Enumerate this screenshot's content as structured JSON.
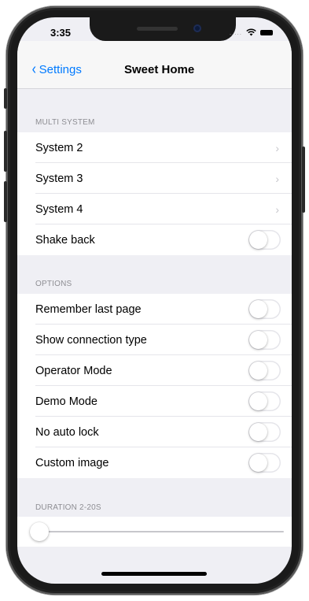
{
  "status_bar": {
    "time": "3:35",
    "signal": "....."
  },
  "nav": {
    "back_label": "Settings",
    "title": "Sweet Home"
  },
  "sections": {
    "multi_system": {
      "header": "MULTI SYSTEM",
      "rows": [
        {
          "label": "System 2",
          "control": "chevron"
        },
        {
          "label": "System 3",
          "control": "chevron"
        },
        {
          "label": "System 4",
          "control": "chevron"
        },
        {
          "label": "Shake back",
          "control": "toggle",
          "on": false
        }
      ]
    },
    "options": {
      "header": "OPTIONS",
      "rows": [
        {
          "label": "Remember last page",
          "control": "toggle",
          "on": false
        },
        {
          "label": "Show connection type",
          "control": "toggle",
          "on": false
        },
        {
          "label": "Operator Mode",
          "control": "toggle",
          "on": false
        },
        {
          "label": "Demo Mode",
          "control": "toggle",
          "on": false
        },
        {
          "label": "No auto lock",
          "control": "toggle",
          "on": false
        },
        {
          "label": "Custom image",
          "control": "toggle",
          "on": false
        }
      ]
    },
    "duration": {
      "header": "DURATION 2-20S",
      "slider_fraction": 0
    }
  },
  "icons": {
    "back": "chevron-left-icon",
    "disclosure": "chevron-right-icon",
    "wifi": "wifi-icon",
    "battery": "battery-icon",
    "chevron_glyph": "›",
    "back_glyph": "‹"
  },
  "colors": {
    "accent": "#007aff",
    "background": "#efeff4",
    "toggle_off_border": "#e5e5ea",
    "header_text": "#8e8e93"
  }
}
